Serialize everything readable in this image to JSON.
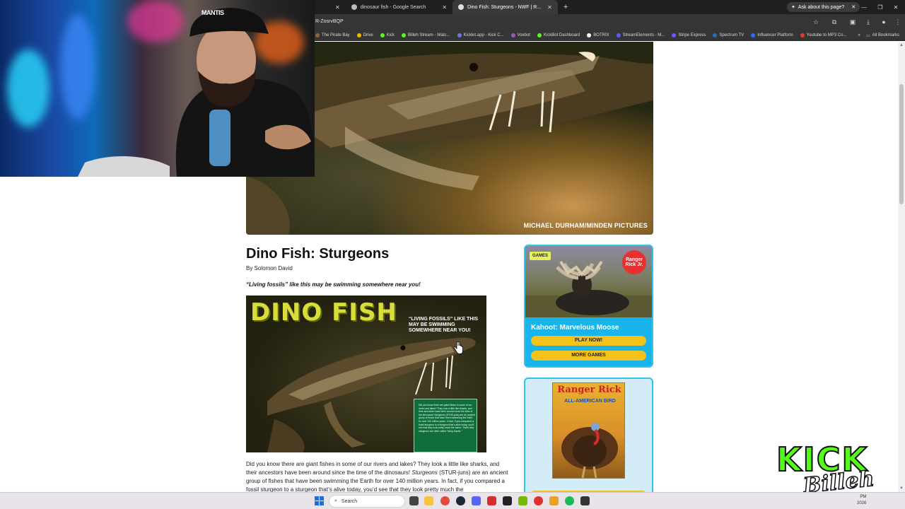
{
  "browser": {
    "tabs": [
      {
        "label": "dinosaur fish - Google Search",
        "active": false
      },
      {
        "label": "Dino Fish: Sturgeons - NWF | R...",
        "active": true
      }
    ],
    "new_tab_label": "+",
    "ask_button": "Ask about this page?",
    "url": "R-ZosrvBQP",
    "bookmarks": [
      {
        "label": "The Pirate Bay",
        "color": "#8a6a3a"
      },
      {
        "label": "Drive",
        "color": "#f4b400"
      },
      {
        "label": "Kick",
        "color": "#53fc18"
      },
      {
        "label": "Billeh Stream - Watc...",
        "color": "#53fc18"
      },
      {
        "label": "Kicklet.app - Kick C...",
        "color": "#6c7ae0"
      },
      {
        "label": "Voxbot",
        "color": "#9b59b6"
      },
      {
        "label": "KickBot Dashboard",
        "color": "#53fc18"
      },
      {
        "label": "BOTRIX",
        "color": "#ffffff"
      },
      {
        "label": "StreamElements - M...",
        "color": "#5b5bff"
      },
      {
        "label": "Stripe Express",
        "color": "#635bff"
      },
      {
        "label": "Spectrum TV",
        "color": "#1e73be"
      },
      {
        "label": "Influencer Platform",
        "color": "#2d6df6"
      },
      {
        "label": "Youtube to MP3 Co...",
        "color": "#e53935"
      }
    ],
    "all_bookmarks": "All Bookmarks"
  },
  "hero": {
    "credit": "MICHAEL DURHAM/MINDEN PICTURES"
  },
  "article": {
    "title": "Dino Fish: Sturgeons",
    "byline": "By Solomon David",
    "tagline": "“Living fossils” like this may be swimming somewhere near you!",
    "image": {
      "headline": "DINO FISH",
      "quote": "“LIVING FOSSILS” LIKE THIS MAY BE SWIMMING SOMEWHERE NEAR YOU!",
      "box_text": "Did you know there are giant fishes in some of our rivers and lakes? They look a little like sharks, and their ancestors have been around since the time of the dinosaurs! Sturgeons (STUR-juns) are an ancient group of fishes that have been swimming the Earth for over 140 million years. In fact, if you compared a fossil sturgeon to a sturgeon that's alive today, you'd see that they look pretty much the same. That's why sturgeons are often called “living fossils.”"
    },
    "body_part1": "Did you know there are giant fishes in some of our rivers and lakes? They look a little like sharks, and their ancestors have been around since the time of the dinosaurs! ",
    "body_italic": "Sturgeons",
    "body_part2": " (STUR-juns) are an ancient group of fishes that have been swimming the Earth for over 140 million years. In fact, if you compared a fossil sturgeon to a sturgeon that’s alive today, you’d see that they look pretty much the"
  },
  "sidebar": {
    "games_card": {
      "badge": "GAMES",
      "logo": "Ranger Rick Jr.",
      "title": "Kahoot: Marvelous Moose",
      "play_button": "PLAY NOW!",
      "more_button": "MORE GAMES"
    },
    "magazine_card": {
      "title": "Ranger Rick",
      "subtitle": "ALL-AMERICAN BIRD"
    }
  },
  "overlay": {
    "cap_text": "MANTIS",
    "kick_word": "KICK",
    "billeh_word": "Billeh"
  },
  "taskbar": {
    "search_placeholder": "Search",
    "time": "PM",
    "date": "2026",
    "icons": [
      {
        "name": "task-view-icon",
        "color": "#444444"
      },
      {
        "name": "file-explorer-icon",
        "color": "#f4c542"
      },
      {
        "name": "chrome-icon",
        "color": "#e24c3d"
      },
      {
        "name": "steam-icon",
        "color": "#1b2838"
      },
      {
        "name": "discord-icon",
        "color": "#5865f2"
      },
      {
        "name": "app-red-icon",
        "color": "#d62d2d"
      },
      {
        "name": "terminal-icon",
        "color": "#222222"
      },
      {
        "name": "nvidia-icon",
        "color": "#76b900"
      },
      {
        "name": "record-icon",
        "color": "#e03030"
      },
      {
        "name": "gear-app-icon",
        "color": "#e8a12b"
      },
      {
        "name": "spotify-icon",
        "color": "#1db954"
      },
      {
        "name": "obs-icon",
        "color": "#333333"
      }
    ]
  }
}
